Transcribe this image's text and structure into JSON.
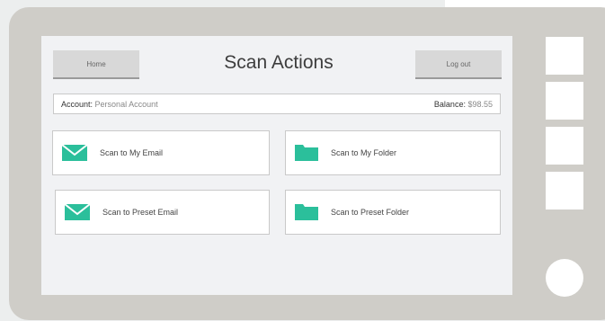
{
  "header": {
    "title": "Scan Actions",
    "home_label": "Home",
    "logout_label": "Log out"
  },
  "account": {
    "label": "Account:",
    "value": "Personal Account",
    "balance_label": "Balance:",
    "balance_value": "$98.55"
  },
  "actions": [
    {
      "label": "Scan to My Email",
      "icon": "envelope-icon"
    },
    {
      "label": "Scan to My Folder",
      "icon": "folder-icon"
    },
    {
      "label": "Scan to Preset Email",
      "icon": "envelope-icon"
    },
    {
      "label": "Scan to Preset Folder",
      "icon": "folder-icon"
    }
  ],
  "colors": {
    "accent": "#2bbf9b",
    "device": "#cfcdc8",
    "screen": "#f1f2f4"
  }
}
